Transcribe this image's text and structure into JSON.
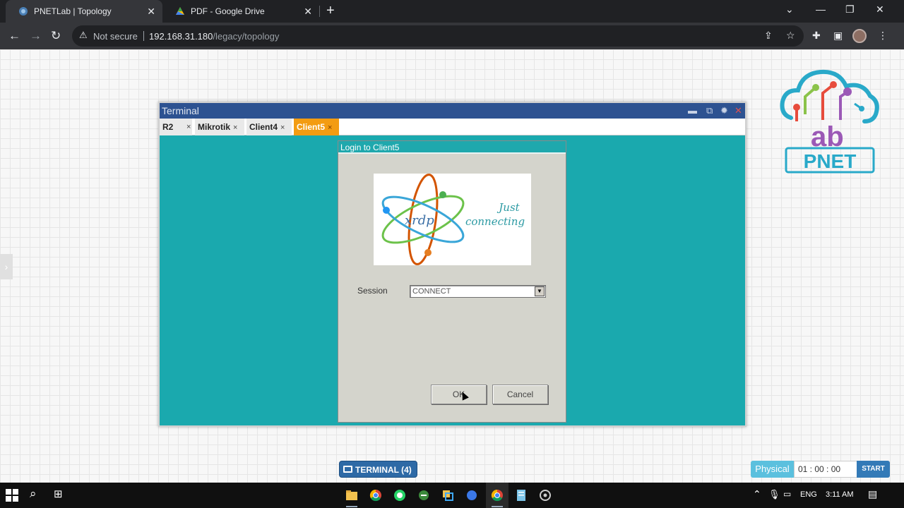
{
  "browser": {
    "tabs": [
      {
        "title": "PNETLab | Topology",
        "active": true
      },
      {
        "title": "PDF - Google Drive",
        "active": false
      }
    ],
    "new_tab_icon": "plus-icon",
    "address": {
      "warning": "Not secure",
      "host": "192.168.31.180",
      "path": "/legacy/topology"
    }
  },
  "terminal": {
    "title": "Terminal",
    "tabs": [
      {
        "label": "R2",
        "active": false
      },
      {
        "label": "Mikrotik",
        "active": false
      },
      {
        "label": "Client4",
        "active": false
      },
      {
        "label": "Client5",
        "active": true
      }
    ],
    "tab_close": "×"
  },
  "login_dialog": {
    "title": "Login to Client5",
    "logo_word": "xrdp",
    "logo_tagline_1": "Just",
    "logo_tagline_2": "connecting",
    "session_label": "Session",
    "session_value": "CONNECT",
    "ok_label": "OK",
    "cancel_label": "Cancel"
  },
  "bottom_bar": {
    "terminal_button": "TERMINAL (4)",
    "mode": "Physical",
    "timer": "01 : 00 : 00",
    "start_label": "START"
  },
  "taskbar": {
    "language": "ENG",
    "time": "3:11 AM"
  },
  "colors": {
    "terminal_bg": "#1aa9ae",
    "terminal_titlebar": "#2d5291",
    "active_tab": "#f39c12"
  }
}
